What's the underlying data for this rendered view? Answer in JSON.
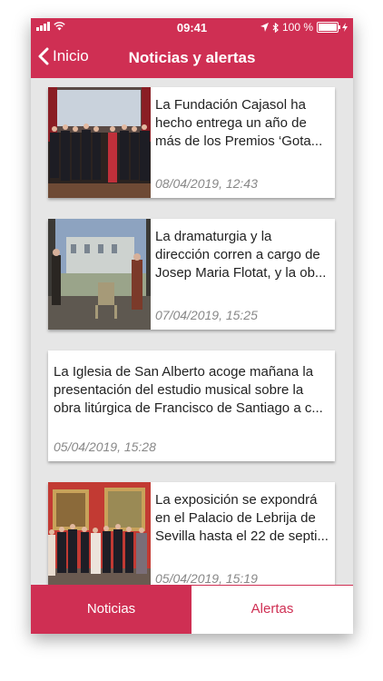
{
  "status_bar": {
    "time": "09:41",
    "battery": "100 %"
  },
  "navbar": {
    "back_label": "Inicio",
    "title": "Noticias y alertas"
  },
  "news": [
    {
      "text": "La Fundación Cajasol ha hecho entrega un año de más de los Premios ‘Gota...",
      "date": "08/04/2019, 12:43",
      "image": "group-photo-award-ceremony"
    },
    {
      "text": "La dramaturgia y la dirección corren a cargo de Josep Maria Flotat, y la ob...",
      "date": "07/04/2019, 15:25",
      "image": "theatre-stage-scene"
    },
    {
      "text": "La Iglesia de San Alberto acoge mañana la presentación del estudio musical sobre la obra litúrgica de Francisco de Santiago a c...",
      "date": "05/04/2019, 15:28",
      "image": ""
    },
    {
      "text": "La exposición se expondrá en el Palacio de Lebrija de Sevilla hasta el 22 de septi...",
      "date": "05/04/2019, 15:19",
      "image": "exhibition-group-photo"
    }
  ],
  "tabs": {
    "noticias": "Noticias",
    "alertas": "Alertas"
  },
  "colors": {
    "accent": "#cf2f53",
    "background": "#e6e6e6"
  }
}
